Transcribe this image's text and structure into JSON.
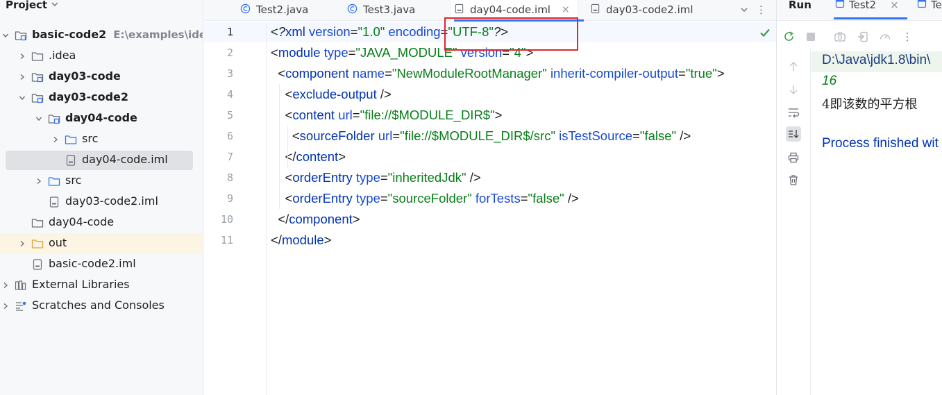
{
  "project": {
    "title": "Project",
    "tree": [
      {
        "label": "basic-code2",
        "path": "E:\\examples\\idea\\b",
        "bold": true,
        "expanded": true,
        "icon": "module-folder-icon"
      },
      {
        "label": ".idea",
        "bold": false,
        "expanded": false,
        "icon": "folder-icon"
      },
      {
        "label": "day03-code",
        "bold": true,
        "expanded": false,
        "icon": "module-folder-icon"
      },
      {
        "label": "day03-code2",
        "bold": true,
        "expanded": true,
        "icon": "module-folder-icon"
      },
      {
        "label": "day04-code",
        "bold": true,
        "expanded": true,
        "icon": "module-folder-icon"
      },
      {
        "label": "src",
        "bold": false,
        "expanded": false,
        "icon": "source-folder-icon"
      },
      {
        "label": "day04-code.iml",
        "bold": false,
        "icon": "iml-file-icon",
        "selected": true
      },
      {
        "label": "src",
        "bold": false,
        "expanded": false,
        "icon": "source-folder-icon"
      },
      {
        "label": "day03-code2.iml",
        "bold": false,
        "icon": "iml-file-icon"
      },
      {
        "label": "day04-code",
        "bold": false,
        "icon": "folder-icon"
      },
      {
        "label": "out",
        "bold": false,
        "expanded": false,
        "icon": "excluded-folder-icon",
        "highlighted": true
      },
      {
        "label": "basic-code2.iml",
        "bold": false,
        "icon": "iml-file-icon"
      },
      {
        "label": "External Libraries",
        "bold": false,
        "expanded": false,
        "icon": "libraries-icon"
      },
      {
        "label": "Scratches and Consoles",
        "bold": false,
        "expanded": false,
        "icon": "scratches-icon"
      }
    ]
  },
  "editor": {
    "tabs": [
      {
        "label": "Test2.java",
        "icon": "java-class-icon"
      },
      {
        "label": "Test3.java",
        "icon": "java-class-icon"
      },
      {
        "label": "day04-code.iml",
        "icon": "iml-file-icon",
        "active": true,
        "close": "×"
      },
      {
        "label": "day03-code2.iml",
        "icon": "iml-file-icon"
      }
    ],
    "tabs_overflow": "⌄",
    "tabs_menu": "⋮",
    "line_numbers": [
      "1",
      "2",
      "3",
      "4",
      "5",
      "6",
      "7",
      "8",
      "9",
      "10",
      "11"
    ],
    "lines": [
      [
        [
          "pl",
          "<"
        ],
        [
          "it",
          "?"
        ],
        [
          "tg",
          "xml "
        ],
        [
          "at",
          "version"
        ],
        [
          "pl",
          "="
        ],
        [
          "sv",
          "\"1.0\" "
        ],
        [
          "at",
          "encoding"
        ],
        [
          "pl",
          "="
        ],
        [
          "sv",
          "\"UTF-8\""
        ],
        [
          "it",
          "?"
        ],
        [
          "pl",
          ">"
        ]
      ],
      [
        [
          "pl",
          "<"
        ],
        [
          "tg",
          "module "
        ],
        [
          "at",
          "type"
        ],
        [
          "pl",
          "="
        ],
        [
          "sv",
          "\"JAVA_MODULE\" "
        ],
        [
          "at",
          "version"
        ],
        [
          "pl",
          "="
        ],
        [
          "sv",
          "\"4\""
        ],
        [
          "pl",
          ">"
        ]
      ],
      [
        [
          "pl",
          "  <"
        ],
        [
          "tg",
          "component "
        ],
        [
          "at",
          "name"
        ],
        [
          "pl",
          "="
        ],
        [
          "sv",
          "\"NewModuleRootManager\" "
        ],
        [
          "at",
          "inherit-compiler-output"
        ],
        [
          "pl",
          "="
        ],
        [
          "sv",
          "\"true\""
        ],
        [
          "pl",
          ">"
        ]
      ],
      [
        [
          "pl",
          "    <"
        ],
        [
          "tg",
          "exclude-output "
        ],
        [
          "pl",
          "/>"
        ]
      ],
      [
        [
          "pl",
          "    <"
        ],
        [
          "tg",
          "content "
        ],
        [
          "at",
          "url"
        ],
        [
          "pl",
          "="
        ],
        [
          "sv",
          "\"file://$MODULE_DIR$\""
        ],
        [
          "pl",
          ">"
        ]
      ],
      [
        [
          "pl",
          "      <"
        ],
        [
          "tg",
          "sourceFolder "
        ],
        [
          "at",
          "url"
        ],
        [
          "pl",
          "="
        ],
        [
          "sv",
          "\"file://$MODULE_DIR$/src\" "
        ],
        [
          "at",
          "isTestSource"
        ],
        [
          "pl",
          "="
        ],
        [
          "sv",
          "\"false\" "
        ],
        [
          "pl",
          "/>"
        ]
      ],
      [
        [
          "pl",
          "    </"
        ],
        [
          "tg",
          "content"
        ],
        [
          "pl",
          ">"
        ]
      ],
      [
        [
          "pl",
          "    <"
        ],
        [
          "tg",
          "orderEntry "
        ],
        [
          "at",
          "type"
        ],
        [
          "pl",
          "="
        ],
        [
          "sv",
          "\"inheritedJdk\" "
        ],
        [
          "pl",
          "/>"
        ]
      ],
      [
        [
          "pl",
          "    <"
        ],
        [
          "tg",
          "orderEntry "
        ],
        [
          "at",
          "type"
        ],
        [
          "pl",
          "="
        ],
        [
          "sv",
          "\"sourceFolder\" "
        ],
        [
          "at",
          "forTests"
        ],
        [
          "pl",
          "="
        ],
        [
          "sv",
          "\"false\" "
        ],
        [
          "pl",
          "/>"
        ]
      ],
      [
        [
          "pl",
          "  </"
        ],
        [
          "tg",
          "component"
        ],
        [
          "pl",
          ">"
        ]
      ],
      [
        [
          "pl",
          "</"
        ],
        [
          "tg",
          "module"
        ],
        [
          "pl",
          ">"
        ]
      ]
    ],
    "inspection_status": "check-icon"
  },
  "run": {
    "title": "Run",
    "tabs": [
      {
        "label": "Test2",
        "close": "×",
        "active": true
      },
      {
        "label": "Te"
      }
    ],
    "console": {
      "command": "D:\\Java\\jdk1.8\\bin\\",
      "result": "16",
      "message": "4即该数的平方根",
      "finished": "Process finished wit"
    }
  },
  "colors": {
    "accent": "#3574f0",
    "tag": "#0033b3",
    "attribute": "#174ad4",
    "string": "#067d17",
    "annotation_box": "#e0242e"
  }
}
